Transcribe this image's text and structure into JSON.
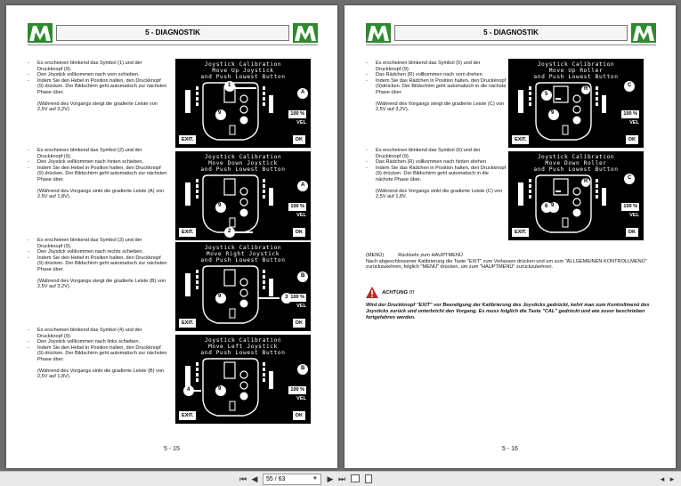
{
  "header": {
    "title": "5 - DIAGNOSTIK"
  },
  "left_page": {
    "page_number": "5 - 15",
    "blocks": [
      {
        "items": [
          "Es erscheinen blinkend das Symbol (1) und der Druckknopf (9).",
          "Den Joystick vollkommen nach vorn schieben.",
          "Indem Sie den Hebel in Position halten, den Druckknopf (9) drücken. Der Bildschirm geht automatisch zur nächsten Phase über."
        ],
        "note": "(Während des Vorgangs steigt die gradierte Leiste von 2,5V auf 3,2V).",
        "screen": {
          "line1": "Joystick Calibration",
          "line2": "Move Up Joystick",
          "line3": "and Push Lowest Button",
          "exit": "EXIT.",
          "ok": "OK",
          "percent": "100 %",
          "vel": "VEL",
          "callout": "1",
          "side": "A",
          "knob": "9"
        }
      },
      {
        "items": [
          "Es erscheinen blinkend das Symbol (2) und der Druckknopf (9).",
          "Den Joystick vollkommen nach hinten schieben.",
          "Indem Sie den Hebel in Position halten, den Druckknopf (9) drücken. Der Bildschirm geht automatisch zur nächsten Phase über."
        ],
        "note": "(Während des Vorgangs sinkt die gradierte Leiste (A) von 2,5V auf 1,8V).",
        "screen": {
          "line1": "Joystick Calibration",
          "line2": "Move Down Joystick",
          "line3": "and Push Lowest Button",
          "exit": "EXIT.",
          "ok": "OK",
          "percent": "100 %",
          "vel": "VEL",
          "callout": "2",
          "side": "A",
          "knob": "9"
        }
      },
      {
        "items": [
          "Es erscheinen blinkend das Symbol (3) und der Druckknopf (9).",
          "Den Joystick vollkommen nach rechts schieben.",
          "Indem Sie den Hebel in Position halten, den Druckknopf (9) drücken. Der Bildschirm geht automatisch zur nächsten Phase über."
        ],
        "note": "(Während des Vorgangs steigt die gradierte Leiste (B) von 2,5V auf 3,2V).",
        "screen": {
          "line1": "Joystick Calibration",
          "line2": "Move Right Joystick",
          "line3": "and Push Lowest Button",
          "exit": "EXIT.",
          "ok": "OK",
          "percent": "100 %",
          "vel": "VEL",
          "callout": "3",
          "side": "B",
          "knob": "9"
        }
      },
      {
        "items": [
          "Es erscheinen blinkend das Symbol (4) und der Druckknopf (9).",
          "Den Joystick vollkommen nach links schieben.",
          "Indem Sie den Hebel in Position halten, den Druckknopf (9) drücken. Der Bildschirm geht automatisch zur nächsten Phase über."
        ],
        "note": "(Während des Vorgangs sinkt die gradierte Leiste (B) von 2,5V auf 1,8V).",
        "screen": {
          "line1": "Joystick Calibration",
          "line2": "Move Left Joystick",
          "line3": "and Push Lowest Button",
          "exit": "EXIT.",
          "ok": "OK",
          "percent": "100 %",
          "vel": "VEL",
          "callout": "4",
          "side": "B",
          "knob": "9"
        }
      }
    ]
  },
  "right_page": {
    "page_number": "5 - 16",
    "blocks": [
      {
        "items": [
          "Es erscheinen blinkend das Symbol (5) und der Druckknopf (9).",
          "Das Rädchen (R) vollkommen nach vorn drehen",
          "Indem Sie das Rädchen in Position halten, den Druckknopf (9)drücken. Der Bildschirm geht automatisch in die nächste Phase über."
        ],
        "note": "(Während des Vorgangs steigt die gradierte Leiste (C) von 2,5V auf 3,2V).",
        "screen": {
          "line1": "Joystick Calibration",
          "line2": "Move Up Roller",
          "line3": "and Push Lowest Button",
          "exit": "EXIT.",
          "ok": "OK",
          "percent": "100 %",
          "vel": "VEL",
          "callout": "5",
          "side": "C",
          "knob": "9",
          "roller": "R"
        }
      },
      {
        "items": [
          "Es erscheinen blinkend das Symbol (6) und der Druckknopf (9).",
          "Das Rädchen (R) vollkommen nach hinten drehen",
          "Indem Sie das Rädchen in Position halten, den Druckknopf (9) drücken. Der Bildschirm geht automatisch in die nächste Phase über."
        ],
        "note": "(Während des Vorgangs sinkt die gradierte Leiste (C) von 2,5V auf 1,8V.",
        "screen": {
          "line1": "Joystick Calibration",
          "line2": "Move Down Roller",
          "line3": "and Push Lowest Button",
          "exit": "EXIT.",
          "ok": "OK",
          "percent": "100 %",
          "vel": "VEL",
          "callout": "6",
          "side": "C",
          "knob": "9",
          "roller": "R"
        }
      }
    ],
    "menu": {
      "label": "(MENÜ)",
      "title": "Rückkehr zum HAUPTMENÜ",
      "text": "Nach abgeschlossener Kalibrierung die Taste \"EXIT\" zum Verlassen drücken und um zum \"ALLGEMEINEN KONTROLLMENÜ\" zurückzukehren, folglich \"MENÜ\" drücken, um zum \"HAUPTMENÜ\" zurückzukehren."
    },
    "warning": {
      "title": "ACHTUNG !!!",
      "text": "Wird der Druckknopf \"EXIT\" vor Beendigung der Kalibrierung des Joysticks gedrückt, kehrt man zum Kontrollmenü des Joysticks zurück und unterbricht den Vorgang. Es muss folglich die Taste \"CAL\" gedrückt und wie zuvor beschrieben fortgefahren werden."
    }
  },
  "toolbar": {
    "page_field": "55 / 63"
  },
  "colors": {
    "logo_green": "#2d8a2d",
    "viewer_bg": "#6d6d6d",
    "toolbar_bg": "#e9e9e9"
  },
  "icons": [
    "first-page-icon",
    "prev-page-icon",
    "next-page-icon",
    "last-page-icon",
    "fit-width-icon",
    "fit-page-icon",
    "warning-icon",
    "logo-icon"
  ]
}
